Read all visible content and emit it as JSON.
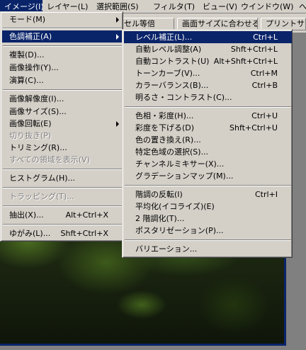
{
  "menubar": {
    "items": [
      "イメージ(I)",
      "レイヤー(L)",
      "選択範囲(S)",
      "フィルタ(T)",
      "ビュー(V)",
      "ウインドウ(W)",
      "ヘ"
    ]
  },
  "optionsbar": {
    "buttons": [
      "セル等倍",
      "画面サイズに合わせる",
      "プリントサイ"
    ]
  },
  "image_menu": {
    "items": [
      {
        "label": "モード(M)",
        "shortcut": "",
        "submenu": true,
        "disabled": false,
        "selected": false
      },
      {
        "label": "色調補正(A)",
        "shortcut": "",
        "submenu": true,
        "disabled": false,
        "selected": true
      },
      {
        "label": "複製(D)...",
        "shortcut": "",
        "submenu": false,
        "disabled": false,
        "selected": false
      },
      {
        "label": "画像操作(Y)...",
        "shortcut": "",
        "submenu": false,
        "disabled": false,
        "selected": false
      },
      {
        "label": "演算(C)...",
        "shortcut": "",
        "submenu": false,
        "disabled": false,
        "selected": false
      },
      {
        "label": "画像解像度(I)...",
        "shortcut": "",
        "submenu": false,
        "disabled": false,
        "selected": false
      },
      {
        "label": "画像サイズ(S)...",
        "shortcut": "",
        "submenu": false,
        "disabled": false,
        "selected": false
      },
      {
        "label": "画像回転(E)",
        "shortcut": "",
        "submenu": true,
        "disabled": false,
        "selected": false
      },
      {
        "label": "切り抜き(P)",
        "shortcut": "",
        "submenu": false,
        "disabled": true,
        "selected": false
      },
      {
        "label": "トリミング(R)...",
        "shortcut": "",
        "submenu": false,
        "disabled": false,
        "selected": false
      },
      {
        "label": "すべての領域を表示(V)",
        "shortcut": "",
        "submenu": false,
        "disabled": true,
        "selected": false
      },
      {
        "label": "ヒストグラム(H)...",
        "shortcut": "",
        "submenu": false,
        "disabled": false,
        "selected": false
      },
      {
        "label": "トラッピング(T)...",
        "shortcut": "",
        "submenu": false,
        "disabled": true,
        "selected": false
      },
      {
        "label": "抽出(X)...",
        "shortcut": "Alt+Ctrl+X",
        "submenu": false,
        "disabled": false,
        "selected": false
      },
      {
        "label": "ゆがみ(L)...",
        "shortcut": "Shft+Ctrl+X",
        "submenu": false,
        "disabled": false,
        "selected": false
      }
    ]
  },
  "adjust_menu": {
    "items": [
      {
        "label": "レベル補正(L)...",
        "shortcut": "Ctrl+L",
        "selected": true
      },
      {
        "label": "自動レベル調整(A)",
        "shortcut": "Shft+Ctrl+L",
        "selected": false
      },
      {
        "label": "自動コントラスト(U)",
        "shortcut": "Alt+Shft+Ctrl+L",
        "selected": false
      },
      {
        "label": "トーンカーブ(V)...",
        "shortcut": "Ctrl+M",
        "selected": false
      },
      {
        "label": "カラーバランス(B)...",
        "shortcut": "Ctrl+B",
        "selected": false
      },
      {
        "label": "明るさ・コントラスト(C)...",
        "shortcut": "",
        "selected": false
      },
      {
        "label": "色相・彩度(H)...",
        "shortcut": "Ctrl+U",
        "selected": false
      },
      {
        "label": "彩度を下げる(D)",
        "shortcut": "Shft+Ctrl+U",
        "selected": false
      },
      {
        "label": "色の置き換え(R)...",
        "shortcut": "",
        "selected": false
      },
      {
        "label": "特定色域の選択(S)...",
        "shortcut": "",
        "selected": false
      },
      {
        "label": "チャンネルミキサー(X)...",
        "shortcut": "",
        "selected": false
      },
      {
        "label": "グラデーションマップ(M)...",
        "shortcut": "",
        "selected": false
      },
      {
        "label": "階調の反転(I)",
        "shortcut": "Ctrl+I",
        "selected": false
      },
      {
        "label": "平均化(イコライズ)(E)",
        "shortcut": "",
        "selected": false
      },
      {
        "label": "2 階調化(T)...",
        "shortcut": "",
        "selected": false
      },
      {
        "label": "ポスタリゼーション(P)...",
        "shortcut": "",
        "selected": false
      },
      {
        "label": "バリエーション...",
        "shortcut": "",
        "selected": false
      }
    ]
  }
}
